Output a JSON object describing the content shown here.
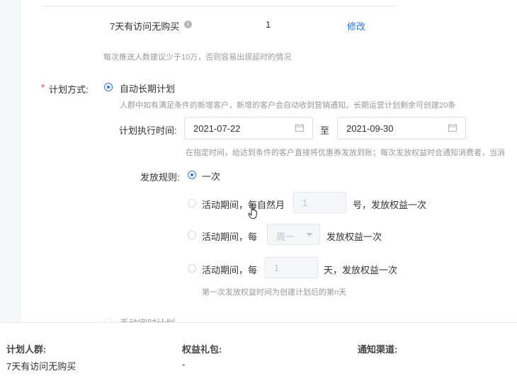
{
  "audience_row": {
    "name": "7天有访问无购买",
    "count": "1",
    "edit_label": "修改"
  },
  "push_tip": "每次推送人数建议少于10万，否则容易出现延时的情况",
  "plan_mode": {
    "required_mark": "*",
    "label": "计划方式:",
    "option_auto": "自动长期计划",
    "auto_desc": "人群中如有满足条件的新增客户，新增的客户会自动收到营销通知。长期运营计划剩余可创建20条",
    "option_manual_partial": "手动定时计划"
  },
  "exec_time": {
    "label": "计划执行时间:",
    "start": "2021-07-22",
    "separator": "至",
    "end": "2021-09-30",
    "note": "在指定时间，给达到条件的客户直接将优惠券发放到账；每次发放权益时会通知消费者，当消"
  },
  "dispatch": {
    "label": "发放规则:",
    "once": "一次",
    "monthly_prefix": "活动期间，每自然月",
    "monthly_value": "1",
    "monthly_suffix": "号，发放权益一次",
    "weekly_prefix": "活动期间，每",
    "weekly_value": "周一",
    "weekly_suffix": "发放权益一次",
    "daily_prefix": "活动期间，每",
    "daily_value": "1",
    "daily_suffix": "天，发放权益一次",
    "daily_note": "第一次发放权益时间为创建计划后的第n天"
  },
  "summary": {
    "crowd_label": "计划人群:",
    "crowd_value": "7天有访问无购买",
    "gift_label": "权益礼包:",
    "gift_value": "-",
    "channel_label": "通知渠道:"
  },
  "colors": {
    "accent": "#2b77ee",
    "required": "#e3342f"
  }
}
